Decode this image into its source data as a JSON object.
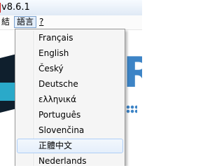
{
  "window": {
    "title": "v8.6.1"
  },
  "menubar": {
    "items": [
      {
        "label": "結",
        "mnemonic": ""
      },
      {
        "label": "語言",
        "mnemonic": ""
      },
      {
        "label": "?",
        "mnemonic": ""
      }
    ]
  },
  "language_menu": {
    "items": [
      {
        "label": "Français"
      },
      {
        "label": "English"
      },
      {
        "label": "Český"
      },
      {
        "label": "Deutsche"
      },
      {
        "label": "ελληνικά"
      },
      {
        "label": "Português"
      },
      {
        "label": "Slovenčina"
      },
      {
        "label": "正體中文",
        "highlighted": true
      },
      {
        "label": "Nederlands"
      }
    ]
  },
  "background_art": {
    "letter": "R"
  },
  "colors": {
    "menu_hover_border": "#aecef7",
    "menubar_active_border": "#7da2ce",
    "art_blue": "#3d84c6",
    "art_dark": "#0f1f2d",
    "art_teal": "#2aa9c9"
  }
}
